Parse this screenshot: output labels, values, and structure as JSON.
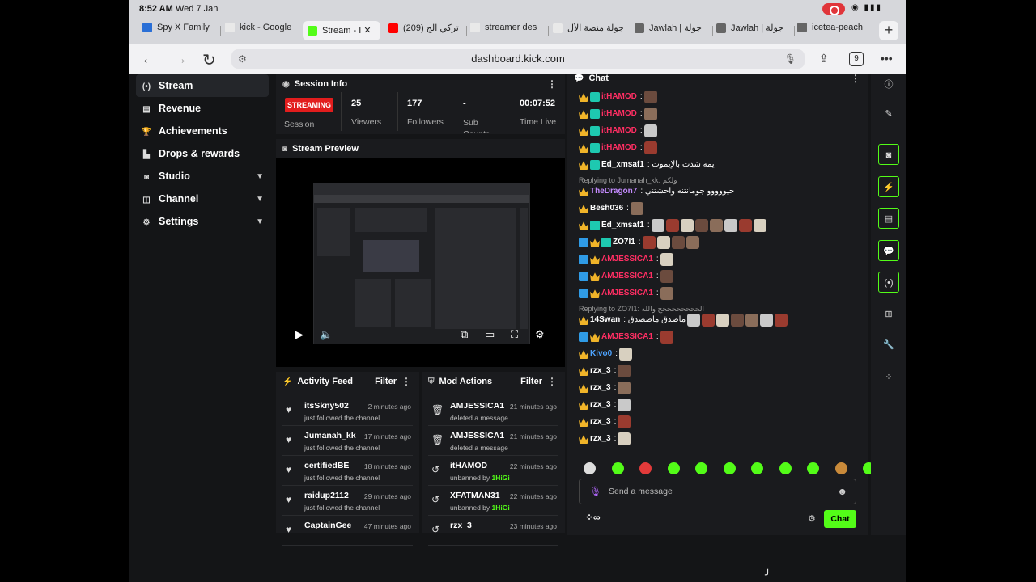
{
  "status": {
    "time": "8:52 AM",
    "date": "Wed 7 Jan"
  },
  "tabs": [
    {
      "label": "Spy X Family",
      "icon": "crunchyroll-icon",
      "color": "#2a6fd6"
    },
    {
      "label": "kick - Google",
      "icon": "google-icon",
      "color": "#e9e9e9"
    },
    {
      "label": "Stream - I",
      "icon": "kick-icon",
      "color": "#53fc18"
    },
    {
      "label": "(209) تركي الج",
      "icon": "youtube-icon",
      "color": "#ff0000"
    },
    {
      "label": "streamer des",
      "icon": "google-icon",
      "color": "#e9e9e9"
    },
    {
      "label": "جولة منصة الأل",
      "icon": "google-icon",
      "color": "#e9e9e9"
    },
    {
      "label": "Jawlah | جولة",
      "icon": "globe-icon",
      "color": "#666666"
    },
    {
      "label": "Jawlah | جولة",
      "icon": "globe-icon",
      "color": "#666666"
    },
    {
      "label": "icetea-peach",
      "icon": "site-icon",
      "color": "#666666"
    }
  ],
  "url": "dashboard.kick.com",
  "tab_count": "9",
  "sidebar": [
    {
      "label": "Stream",
      "icon": "(•)",
      "chev": false
    },
    {
      "label": "Revenue",
      "icon": "▤",
      "chev": false
    },
    {
      "label": "Achievements",
      "icon": "🏆",
      "chev": false
    },
    {
      "label": "Drops & rewards",
      "icon": "▙",
      "chev": false
    },
    {
      "label": "Studio",
      "icon": "◙",
      "chev": true
    },
    {
      "label": "Channel",
      "icon": "◫",
      "chev": true
    },
    {
      "label": "Settings",
      "icon": "⚙",
      "chev": true
    }
  ],
  "session": {
    "title": "Session Info",
    "badge": "STREAMING",
    "session_label": "Session",
    "viewers": "25",
    "viewers_label": "Viewers",
    "followers": "177",
    "followers_label": "Followers",
    "subs": "-",
    "subs_label": "Sub Counts",
    "time_live": "00:07:52",
    "time_live_label": "Time Live"
  },
  "preview": {
    "title": "Stream Preview"
  },
  "activity": {
    "title": "Activity Feed",
    "filter": "Filter",
    "items": [
      {
        "user": "itsSkny502",
        "time": "2 minutes ago",
        "sub": "just followed the channel"
      },
      {
        "user": "Jumanah_kk",
        "time": "17 minutes ago",
        "sub": "just followed the channel"
      },
      {
        "user": "certifiedBE",
        "time": "18 minutes ago",
        "sub": "just followed the channel"
      },
      {
        "user": "raidup2112",
        "time": "29 minutes ago",
        "sub": "just followed the channel"
      },
      {
        "user": "CaptainGee",
        "time": "47 minutes ago",
        "sub": ""
      }
    ]
  },
  "mod": {
    "title": "Mod Actions",
    "filter": "Filter",
    "items": [
      {
        "user": "AMJESSICA1",
        "time": "21 minutes ago",
        "sub": "deleted a message",
        "by": "",
        "icon": "trash-icon"
      },
      {
        "user": "AMJESSICA1",
        "time": "21 minutes ago",
        "sub": "deleted a message",
        "by": "",
        "icon": "trash-icon"
      },
      {
        "user": "itHAMOD",
        "time": "22 minutes ago",
        "sub": "unbanned by",
        "by": "1HiGi",
        "icon": "undo-icon"
      },
      {
        "user": "XFATMAN31",
        "time": "22 minutes ago",
        "sub": "unbanned by",
        "by": "1HiGi",
        "icon": "undo-icon"
      },
      {
        "user": "rzx_3",
        "time": "23 minutes ago",
        "sub": "",
        "by": "",
        "icon": "undo-icon"
      }
    ]
  },
  "chat": {
    "title": "Chat",
    "placeholder": "Send a message",
    "send": "Chat",
    "messages": [
      {
        "user": "itHAMOD",
        "color": "#ff2e63",
        "badges": [
          "crown",
          "sub"
        ],
        "text": ":",
        "emotes": 1,
        "reply": ""
      },
      {
        "user": "itHAMOD",
        "color": "#ff2e63",
        "badges": [
          "crown",
          "sub"
        ],
        "text": ":",
        "emotes": 1,
        "reply": ""
      },
      {
        "user": "itHAMOD",
        "color": "#ff2e63",
        "badges": [
          "crown",
          "sub"
        ],
        "text": ":",
        "emotes": 1,
        "reply": ""
      },
      {
        "user": "itHAMOD",
        "color": "#ff2e63",
        "badges": [
          "crown",
          "sub"
        ],
        "text": ":",
        "emotes": 1,
        "reply": ""
      },
      {
        "user": "Ed_xmsaf1",
        "color": "#ffffff",
        "badges": [
          "crown",
          "sub"
        ],
        "text": ": يمه شدت بالإيموت",
        "emotes": 0,
        "reply": ""
      },
      {
        "user": "TheDragon7",
        "color": "#c48bff",
        "badges": [
          "crown"
        ],
        "text": ": حيووووو جومانتنه واحشتني",
        "emotes": 0,
        "reply": "Replying to Jumanah_kk: ولكم"
      },
      {
        "user": "Besh036",
        "color": "#ffffff",
        "badges": [
          "crown"
        ],
        "text": ":",
        "emotes": 1,
        "reply": ""
      },
      {
        "user": "Ed_xmsaf1",
        "color": "#ffffff",
        "badges": [
          "crown",
          "sub"
        ],
        "text": ":",
        "emotes": 8,
        "reply": ""
      },
      {
        "user": "ZO7I1",
        "color": "#ffffff",
        "badges": [
          "mod",
          "crown",
          "sub"
        ],
        "text": ":",
        "emotes": 4,
        "reply": ""
      },
      {
        "user": "AMJESSICA1",
        "color": "#ff2e63",
        "badges": [
          "mod",
          "crown"
        ],
        "text": ":",
        "emotes": 1,
        "reply": ""
      },
      {
        "user": "AMJESSICA1",
        "color": "#ff2e63",
        "badges": [
          "mod",
          "crown"
        ],
        "text": ":",
        "emotes": 1,
        "reply": ""
      },
      {
        "user": "AMJESSICA1",
        "color": "#ff2e63",
        "badges": [
          "mod",
          "crown"
        ],
        "text": ":",
        "emotes": 1,
        "reply": ""
      },
      {
        "user": "14Swan",
        "color": "#ffffff",
        "badges": [
          "crown"
        ],
        "text": ": ماصدق ماصصدق",
        "emotes": 7,
        "reply": "Replying to ZO7I1: الححححححححح والله"
      },
      {
        "user": "AMJESSICA1",
        "color": "#ff2e63",
        "badges": [
          "mod",
          "crown"
        ],
        "text": ":",
        "emotes": 1,
        "reply": ""
      },
      {
        "user": "Kivo0",
        "color": "#4da3ff",
        "badges": [
          "crown"
        ],
        "text": ":",
        "emotes": 1,
        "reply": ""
      },
      {
        "user": "rzx_3",
        "color": "#ffffff",
        "badges": [
          "crown"
        ],
        "text": ":",
        "emotes": 1,
        "reply": ""
      },
      {
        "user": "rzx_3",
        "color": "#ffffff",
        "badges": [
          "crown"
        ],
        "text": ":",
        "emotes": 1,
        "reply": ""
      },
      {
        "user": "rzx_3",
        "color": "#ffffff",
        "badges": [
          "crown"
        ],
        "text": ":",
        "emotes": 1,
        "reply": ""
      },
      {
        "user": "rzx_3",
        "color": "#ffffff",
        "badges": [
          "crown"
        ],
        "text": ":",
        "emotes": 1,
        "reply": ""
      },
      {
        "user": "rzx_3",
        "color": "#ffffff",
        "badges": [
          "crown"
        ],
        "text": ":",
        "emotes": 1,
        "reply": ""
      }
    ]
  },
  "colors": {
    "accent": "#53fc18",
    "live": "#e21d1d"
  }
}
